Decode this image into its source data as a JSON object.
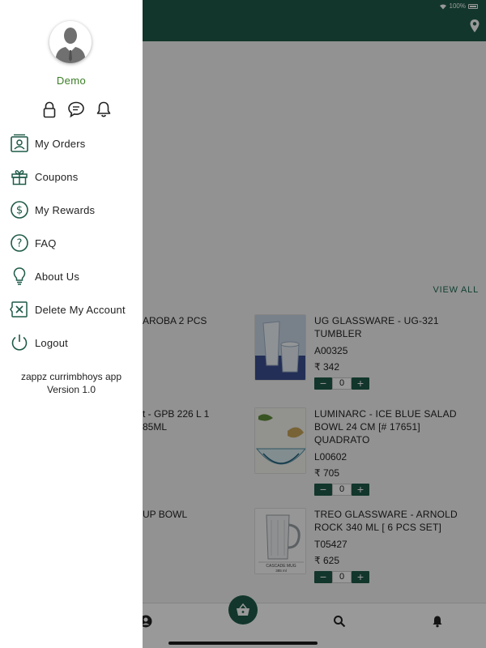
{
  "status": {
    "battery": "100%"
  },
  "section": {
    "view_all": "VIEW ALL"
  },
  "products": [
    {
      "left_text": [
        "AROBA 2 PCS"
      ],
      "title": "UG GLASSWARE - UG-321 TUMBLER",
      "code": "A00325",
      "price": "₹ 342",
      "qty": "0"
    },
    {
      "left_text": [
        "t - GPB 226 L 1",
        "85ML"
      ],
      "title": "LUMINARC - ICE BLUE SALAD BOWL 24 CM [# 17651] QUADRATO",
      "code": "L00602",
      "price": "₹ 705",
      "qty": "0"
    },
    {
      "left_text": [
        "UP BOWL"
      ],
      "title": "TREO GLASSWARE - ARNOLD ROCK 340 ML [ 6 PCS SET]",
      "code": "T05427",
      "price": "₹ 625",
      "qty": "0",
      "image_caption": "CASCADE MUG",
      "image_caption2": "385 ml"
    }
  ],
  "stepper": {
    "minus": "−",
    "plus": "+"
  },
  "drawer": {
    "user_name": "Demo",
    "menu": [
      {
        "label": "My Orders",
        "icon": "orders-icon"
      },
      {
        "label": "Coupons",
        "icon": "gift-icon"
      },
      {
        "label": "My Rewards",
        "icon": "dollar-icon"
      },
      {
        "label": "FAQ",
        "icon": "question-icon"
      },
      {
        "label": "About Us",
        "icon": "lightbulb-icon"
      },
      {
        "label": "Delete My Account",
        "icon": "delete-account-icon"
      },
      {
        "label": "Logout",
        "icon": "power-icon"
      }
    ],
    "app_name": "zappz currimbhoys app",
    "version": "Version 1.0"
  },
  "colors": {
    "primary": "#1e5a48",
    "accent_green": "#3a7d24"
  }
}
